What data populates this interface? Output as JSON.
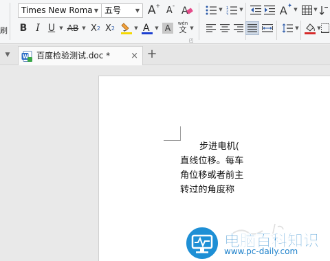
{
  "ribbon": {
    "partial_label": "刷",
    "font_name": "Times New Roma",
    "font_size": "五号",
    "buttons": {
      "grow_font": "A",
      "shrink_font": "A",
      "bold": "B",
      "italic": "I",
      "underline": "U",
      "strikethrough": "AB",
      "superscript": "X",
      "superscript_mark": "2",
      "subscript": "X",
      "subscript_mark": "2",
      "font_color": "A",
      "char_shading": "A",
      "phonetic_top": "wén",
      "phonetic_bottom": "文",
      "text_effect": "A"
    },
    "colors": {
      "highlight": "#f5d800",
      "font_color": "#1c3fd1",
      "fill": "#d62a2a"
    }
  },
  "tabs": {
    "active_title": "百度检验测试.doc *",
    "close_glyph": "×",
    "new_tab_glyph": "+"
  },
  "document": {
    "lines": [
      "步进电机(",
      "直线位移。每车",
      "角位移或者前主",
      "转过的角度称"
    ]
  },
  "watermark": {
    "title": "电脑百科知识",
    "url": "www.pc-daily.com"
  }
}
